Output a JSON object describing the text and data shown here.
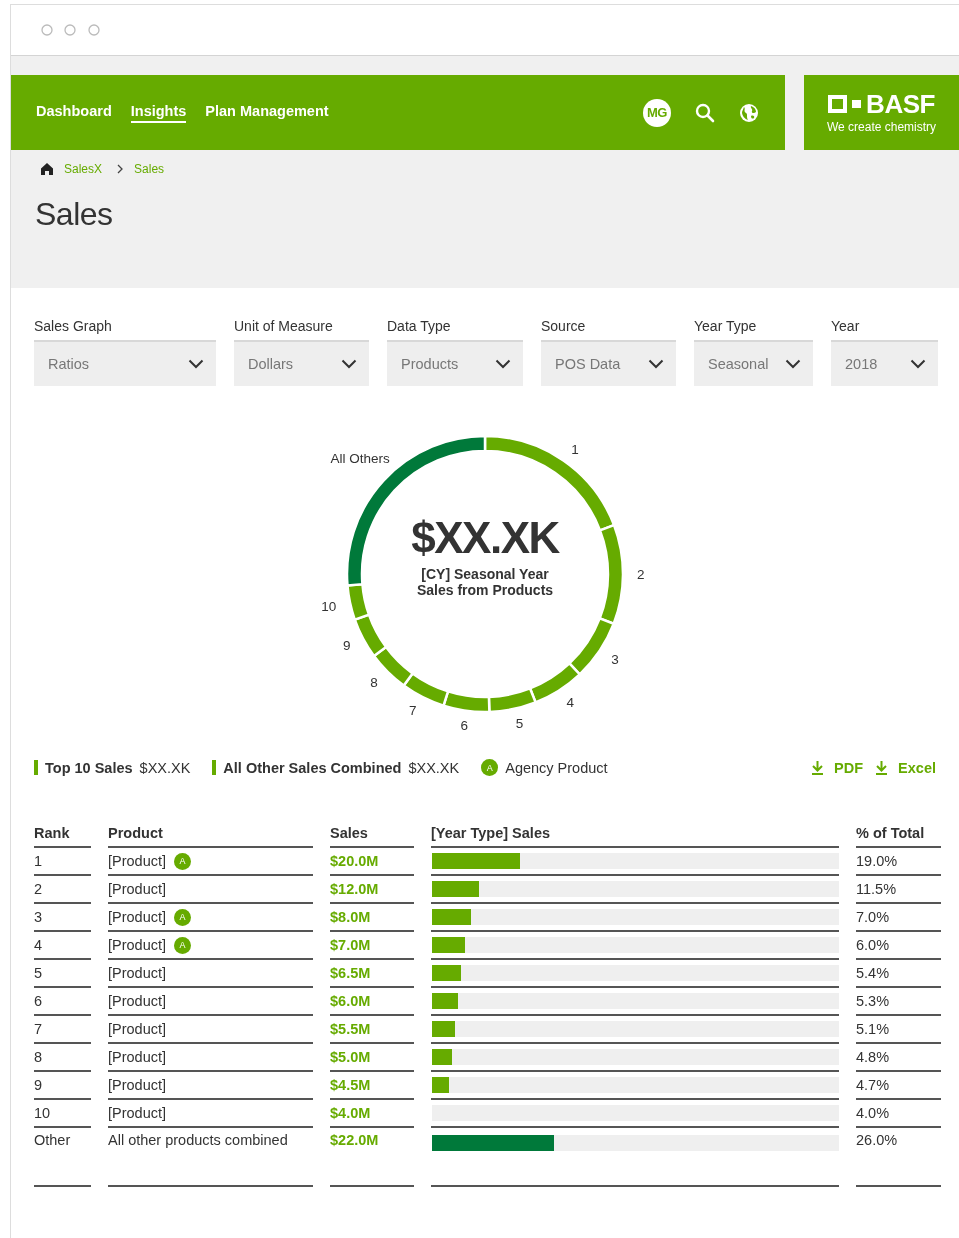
{
  "nav": {
    "items": [
      {
        "label": "Dashboard",
        "selected": false
      },
      {
        "label": "Insights",
        "selected": true
      },
      {
        "label": "Plan Management",
        "selected": false
      }
    ],
    "avatar": "MG"
  },
  "brand": {
    "name": "BASF",
    "tagline": "We create chemistry"
  },
  "breadcrumb": [
    "SalesX",
    "Sales"
  ],
  "page_title": "Sales",
  "filters": [
    {
      "label": "Sales Graph",
      "value": "Ratios"
    },
    {
      "label": "Unit of Measure",
      "value": "Dollars"
    },
    {
      "label": "Data Type",
      "value": "Products"
    },
    {
      "label": "Source",
      "value": "POS Data"
    },
    {
      "label": "Year Type",
      "value": "Seasonal"
    },
    {
      "label": "Year",
      "value": "2018"
    }
  ],
  "donut": {
    "value": "$XX.XK",
    "caption": [
      "[CY] Seasonal Year",
      "Sales from Products"
    ],
    "chart_data": {
      "type": "donut",
      "categories": [
        "1",
        "2",
        "3",
        "4",
        "5",
        "6",
        "7",
        "8",
        "9",
        "10",
        "All Others"
      ],
      "values": [
        19.0,
        11.5,
        7.0,
        6.0,
        5.4,
        5.3,
        5.1,
        4.8,
        4.7,
        4.0,
        26.0
      ],
      "colors": [
        "#66ab00",
        "#66ab00",
        "#66ab00",
        "#66ab00",
        "#66ab00",
        "#66ab00",
        "#66ab00",
        "#66ab00",
        "#66ab00",
        "#66ab00",
        "#00793a"
      ]
    }
  },
  "legend": [
    {
      "kind": "bar",
      "label": "Top 10 Sales",
      "value": "$XX.XK"
    },
    {
      "kind": "bar",
      "label": "All Other Sales Combined",
      "value": "$XX.XK"
    },
    {
      "kind": "badge",
      "badge": "A",
      "label": "Agency Product"
    }
  ],
  "exports": [
    "PDF",
    "Excel"
  ],
  "table": {
    "columns": [
      "Rank",
      "Product",
      "Sales",
      "[Year Type] Sales",
      "% of Total"
    ],
    "rows": [
      {
        "kind": "product",
        "rank": "1",
        "product": "[Product]",
        "badge": "A",
        "sales": "$20.0M",
        "level": 0.216,
        "share": "19.0%"
      },
      {
        "kind": "product",
        "rank": "2",
        "product": "[Product]",
        "sales": "$12.0M",
        "level": 0.115,
        "share": "11.5%"
      },
      {
        "kind": "product",
        "rank": "3",
        "product": "[Product]",
        "badge": "A",
        "sales": "$8.0M",
        "level": 0.096,
        "share": "7.0%"
      },
      {
        "kind": "product",
        "rank": "4",
        "product": "[Product]",
        "badge": "A",
        "sales": "$7.0M",
        "level": 0.08,
        "share": "6.0%"
      },
      {
        "kind": "product",
        "rank": "5",
        "product": "[Product]",
        "sales": "$6.5M",
        "level": 0.071,
        "share": "5.4%"
      },
      {
        "kind": "product",
        "rank": "6",
        "product": "[Product]",
        "sales": "$6.0M",
        "level": 0.064,
        "share": "5.3%"
      },
      {
        "kind": "product",
        "rank": "7",
        "product": "[Product]",
        "sales": "$5.5M",
        "level": 0.056,
        "share": "5.1%"
      },
      {
        "kind": "product",
        "rank": "8",
        "product": "[Product]",
        "sales": "$5.0M",
        "level": 0.049,
        "share": "4.8%"
      },
      {
        "kind": "product",
        "rank": "9",
        "product": "[Product]",
        "sales": "$4.5M",
        "level": 0.042,
        "share": "4.7%"
      },
      {
        "kind": "product",
        "rank": "10",
        "product": "[Product]",
        "sales": "$4.0M",
        "share": "4.0%"
      },
      {
        "kind": "other",
        "rank": "Other",
        "product": "All other products combined",
        "sales": "$22.0M",
        "level": 0.3,
        "share": "26.0%"
      }
    ]
  }
}
